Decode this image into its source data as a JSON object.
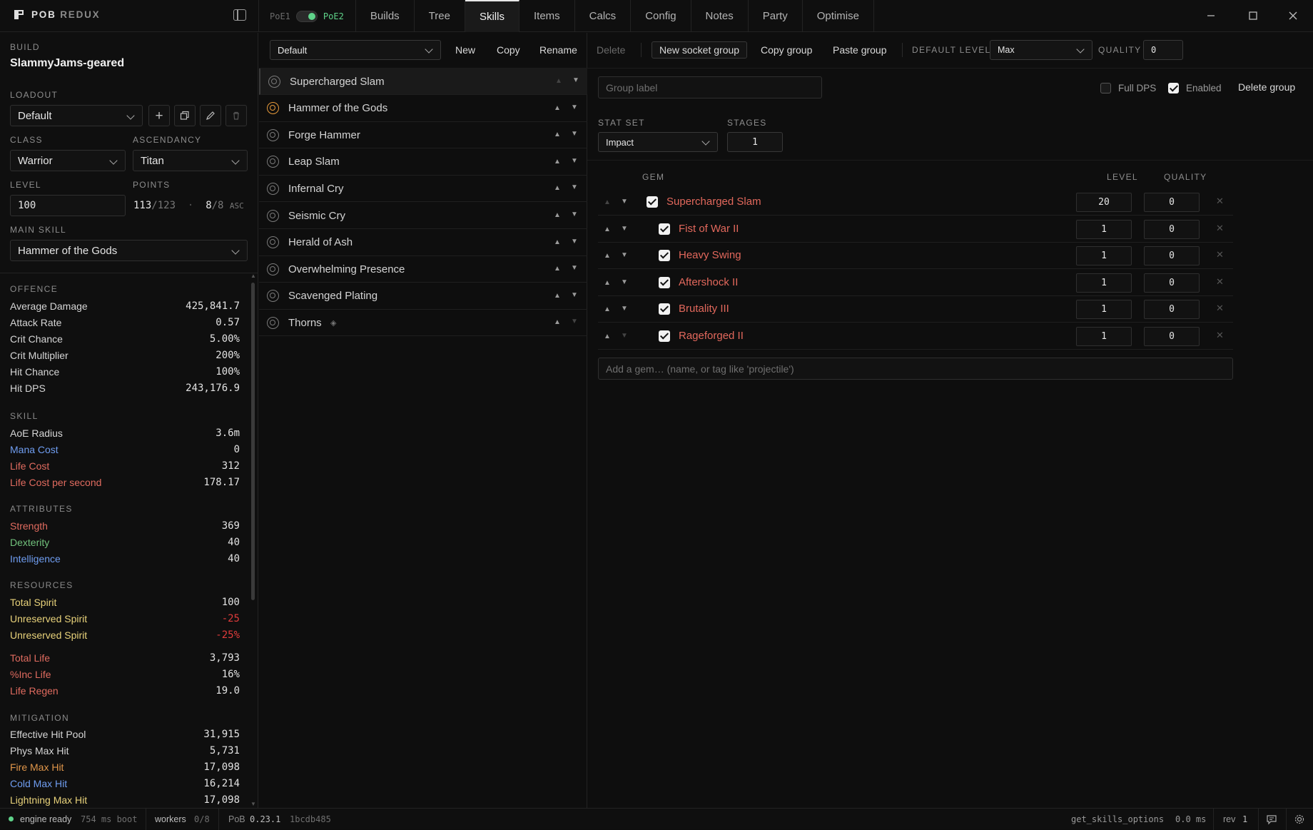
{
  "app": {
    "logo_main": "POB",
    "logo_sub": "REDUX"
  },
  "game_toggle": {
    "poe1": "PoE1",
    "poe2": "PoE2"
  },
  "tabs": [
    "Builds",
    "Tree",
    "Skills",
    "Items",
    "Calcs",
    "Config",
    "Notes",
    "Party",
    "Optimise"
  ],
  "active_tab": "Skills",
  "build": {
    "label": "BUILD",
    "name": "SlammyJams-geared",
    "loadout_label": "LOADOUT",
    "loadout": "Default",
    "class_label": "CLASS",
    "class": "Warrior",
    "ascendancy_label": "ASCENDANCY",
    "ascendancy": "Titan",
    "level_label": "LEVEL",
    "level": "100",
    "points_label": "POINTS",
    "points_used": "113",
    "points_total": "/123",
    "asc_used": "8",
    "asc_total": "/8",
    "asc_suffix": "ASC",
    "main_skill_label": "MAIN SKILL",
    "main_skill": "Hammer of the Gods"
  },
  "stats": {
    "offence_label": "OFFENCE",
    "offence": [
      {
        "name": "Average Damage",
        "value": "425,841.7",
        "color": ""
      },
      {
        "name": "Attack Rate",
        "value": "0.57",
        "color": ""
      },
      {
        "name": "Crit Chance",
        "value": "5.00%",
        "color": ""
      },
      {
        "name": "Crit Multiplier",
        "value": "200%",
        "color": ""
      },
      {
        "name": "Hit Chance",
        "value": "100%",
        "color": ""
      },
      {
        "name": "Hit DPS",
        "value": "243,176.9",
        "color": ""
      }
    ],
    "skill_label": "SKILL",
    "skill": [
      {
        "name": "AoE Radius",
        "value": "3.6m",
        "color": ""
      },
      {
        "name": "Mana Cost",
        "value": "0",
        "color": "blue"
      },
      {
        "name": "Life Cost",
        "value": "312",
        "color": "red"
      },
      {
        "name": "Life Cost per second",
        "value": "178.17",
        "color": "red"
      }
    ],
    "attributes_label": "ATTRIBUTES",
    "attributes": [
      {
        "name": "Strength",
        "value": "369",
        "color": "red"
      },
      {
        "name": "Dexterity",
        "value": "40",
        "color": "green"
      },
      {
        "name": "Intelligence",
        "value": "40",
        "color": "blue"
      }
    ],
    "resources_label": "RESOURCES",
    "resources": [
      {
        "name": "Total Spirit",
        "value": "100",
        "color": "yellow",
        "vcolor": ""
      },
      {
        "name": "Unreserved Spirit",
        "value": "-25",
        "color": "yellow",
        "vcolor": "brightred"
      },
      {
        "name": "Unreserved Spirit",
        "value": "-25%",
        "color": "yellow",
        "vcolor": "brightred"
      }
    ],
    "life": [
      {
        "name": "Total Life",
        "value": "3,793",
        "color": "red"
      },
      {
        "name": "%Inc Life",
        "value": "16%",
        "color": "red"
      },
      {
        "name": "Life Regen",
        "value": "19.0",
        "color": "red"
      }
    ],
    "mitigation_label": "MITIGATION",
    "mitigation": [
      {
        "name": "Effective Hit Pool",
        "value": "31,915",
        "color": ""
      },
      {
        "name": "Phys Max Hit",
        "value": "5,731",
        "color": ""
      },
      {
        "name": "Fire Max Hit",
        "value": "17,098",
        "color": "orange"
      },
      {
        "name": "Cold Max Hit",
        "value": "16,214",
        "color": "blue"
      },
      {
        "name": "Lightning Max Hit",
        "value": "17,098",
        "color": "yellow"
      }
    ]
  },
  "toolbar": {
    "set": "Default",
    "new": "New",
    "copy": "Copy",
    "rename": "Rename",
    "delete": "Delete",
    "new_socket_group": "New socket group",
    "copy_group": "Copy group",
    "paste_group": "Paste group",
    "default_level_label": "DEFAULT LEVEL",
    "default_level": "Max",
    "quality_label": "QUALITY",
    "quality": "0"
  },
  "skill_groups": [
    {
      "name": "Supercharged Slam",
      "selected": true,
      "active": false,
      "up_dim": true,
      "down_dim": false
    },
    {
      "name": "Hammer of the Gods",
      "selected": false,
      "active": true,
      "up_dim": false,
      "down_dim": false
    },
    {
      "name": "Forge Hammer",
      "selected": false,
      "active": false,
      "up_dim": false,
      "down_dim": false
    },
    {
      "name": "Leap Slam",
      "selected": false,
      "active": false,
      "up_dim": false,
      "down_dim": false
    },
    {
      "name": "Infernal Cry",
      "selected": false,
      "active": false,
      "up_dim": false,
      "down_dim": false
    },
    {
      "name": "Seismic Cry",
      "selected": false,
      "active": false,
      "up_dim": false,
      "down_dim": false
    },
    {
      "name": "Herald of Ash",
      "selected": false,
      "active": false,
      "up_dim": false,
      "down_dim": false
    },
    {
      "name": "Overwhelming Presence",
      "selected": false,
      "active": false,
      "up_dim": false,
      "down_dim": false
    },
    {
      "name": "Scavenged Plating",
      "selected": false,
      "active": false,
      "up_dim": false,
      "down_dim": false
    },
    {
      "name": "Thorns",
      "selected": false,
      "active": false,
      "up_dim": false,
      "down_dim": true,
      "diamond": true
    }
  ],
  "group_detail": {
    "group_label_placeholder": "Group label",
    "full_dps": "Full DPS",
    "enabled": "Enabled",
    "delete_group": "Delete group",
    "stat_set_label": "STAT SET",
    "stat_set": "Impact",
    "stages_label": "STAGES",
    "stages": "1",
    "col_gem": "GEM",
    "col_level": "LEVEL",
    "col_quality": "QUALITY",
    "gems": [
      {
        "name": "Supercharged Slam",
        "level": "20",
        "quality": "0",
        "support": false
      },
      {
        "name": "Fist of War II",
        "level": "1",
        "quality": "0",
        "support": true
      },
      {
        "name": "Heavy Swing",
        "level": "1",
        "quality": "0",
        "support": true
      },
      {
        "name": "Aftershock II",
        "level": "1",
        "quality": "0",
        "support": true
      },
      {
        "name": "Brutality III",
        "level": "1",
        "quality": "0",
        "support": true
      },
      {
        "name": "Rageforged II",
        "level": "1",
        "quality": "0",
        "support": true
      }
    ],
    "add_gem_placeholder": "Add a gem… (name, or tag like 'projectile')"
  },
  "statusbar": {
    "engine": "engine ready",
    "boot_time": "754 ms boot",
    "workers": "workers",
    "workers_count": "0/8",
    "pob": "PoB",
    "pob_version": "0.23.1",
    "commit": "1bcdb485",
    "op": "get_skills_options",
    "op_time": "0.0 ms",
    "rev": "rev",
    "rev_num": "1"
  }
}
